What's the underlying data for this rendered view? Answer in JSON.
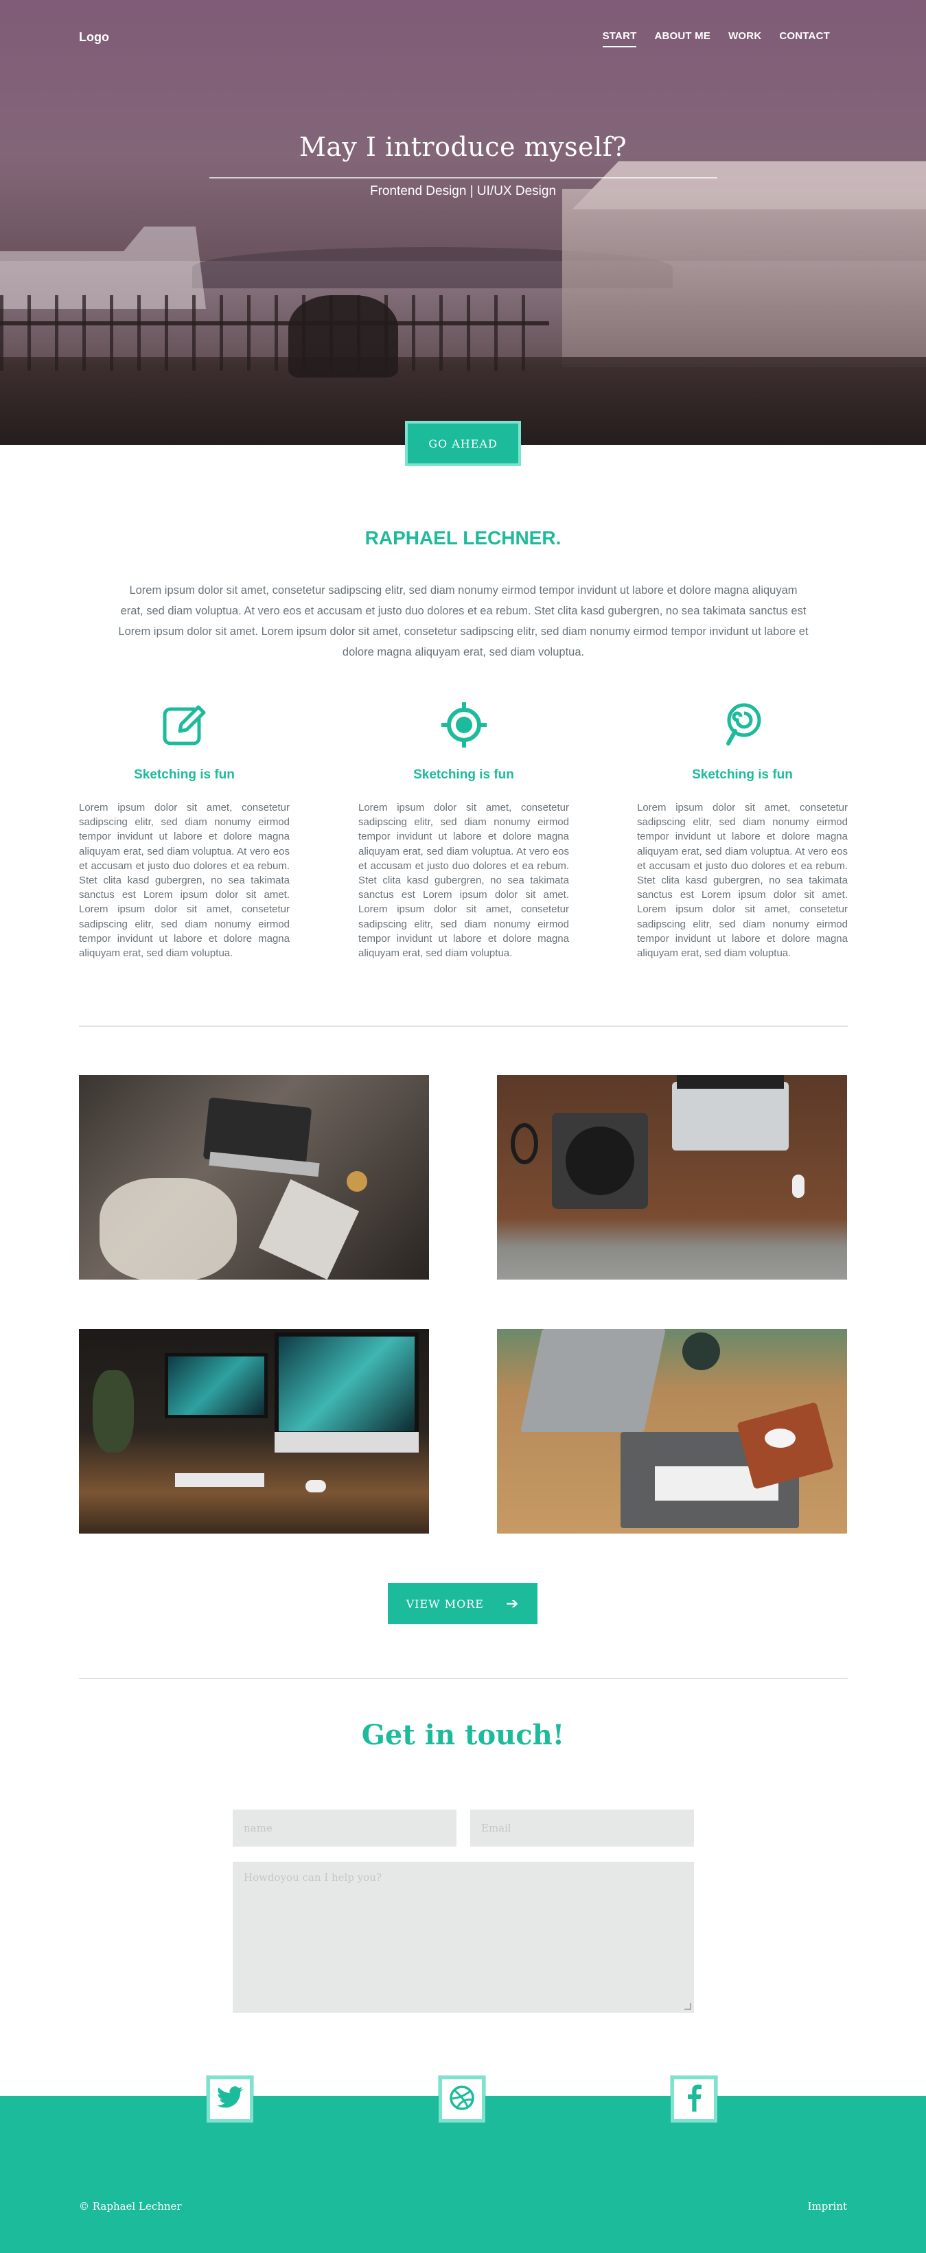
{
  "header": {
    "logo": "Logo",
    "nav": [
      "START",
      "ABOUT ME",
      "WORK",
      "CONTACT"
    ],
    "title": "May I introduce myself?",
    "subtitle": "Frontend Design | UI/UX Design",
    "cta": "GO AHEAD"
  },
  "about": {
    "name": "RAPHAEL LECHNER.",
    "intro": "Lorem ipsum dolor sit amet, consetetur sadipscing elitr, sed diam nonumy eirmod tempor invidunt ut labore et dolore magna aliquyam erat, sed diam voluptua. At vero eos et accusam et justo duo dolores et ea rebum. Stet clita kasd gubergren, no sea takimata sanctus est Lorem ipsum dolor sit amet. Lorem ipsum dolor sit amet, consetetur sadipscing elitr, sed diam nonumy eirmod tempor invidunt ut labore et dolore magna aliquyam erat, sed diam voluptua."
  },
  "features": [
    {
      "icon": "edit-icon",
      "title": "Sketching is fun",
      "text": "Lorem ipsum dolor sit amet, consetetur sadipscing elitr, sed diam nonumy eirmod tempor invidunt ut labore et dolore magna aliquyam erat, sed diam voluptua. At vero eos et accusam et justo duo dolores et ea rebum. Stet clita kasd gubergren, no sea takimata sanctus est Lorem ipsum dolor sit amet. Lorem ipsum dolor sit amet, consetetur sadipscing elitr, sed diam nonumy eirmod tempor invidunt ut labore et dolore magna aliquyam erat, sed diam voluptua."
    },
    {
      "icon": "crosshair-icon",
      "title": "Sketching is fun",
      "text": "Lorem ipsum dolor sit amet, consetetur sadipscing elitr, sed diam nonumy eirmod tempor invidunt ut labore et dolore magna aliquyam erat, sed diam voluptua. At vero eos et accusam et justo duo dolores et ea rebum. Stet clita kasd gubergren, no sea takimata sanctus est Lorem ipsum dolor sit amet. Lorem ipsum dolor sit amet, consetetur sadipscing elitr, sed diam nonumy eirmod tempor invidunt ut labore et dolore magna aliquyam erat, sed diam voluptua."
    },
    {
      "icon": "lollipop-icon",
      "title": "Sketching is fun",
      "text": "Lorem ipsum dolor sit amet, consetetur sadipscing elitr, sed diam nonumy eirmod tempor invidunt ut labore et dolore magna aliquyam erat, sed diam voluptua. At vero eos et accusam et justo duo dolores et ea rebum. Stet clita kasd gubergren, no sea takimata sanctus est Lorem ipsum dolor sit amet. Lorem ipsum dolor sit amet, consetetur sadipscing elitr, sed diam nonumy eirmod tempor invidunt ut labore et dolore magna aliquyam erat, sed diam voluptua."
    }
  ],
  "work": {
    "view_more": "VIEW MORE"
  },
  "contact": {
    "title": "Get in touch!",
    "name_placeholder": "name",
    "email_placeholder": "Email",
    "message_placeholder": "Howdoyou can I help you?"
  },
  "footer": {
    "copyright": "© Raphael Lechner",
    "imprint": "Imprint",
    "social": [
      "twitter-icon",
      "dribbble-icon",
      "facebook-icon"
    ]
  },
  "colors": {
    "accent": "#1cbb9b",
    "accent_light": "#7de3ce",
    "field_bg": "#e6e8e8"
  }
}
